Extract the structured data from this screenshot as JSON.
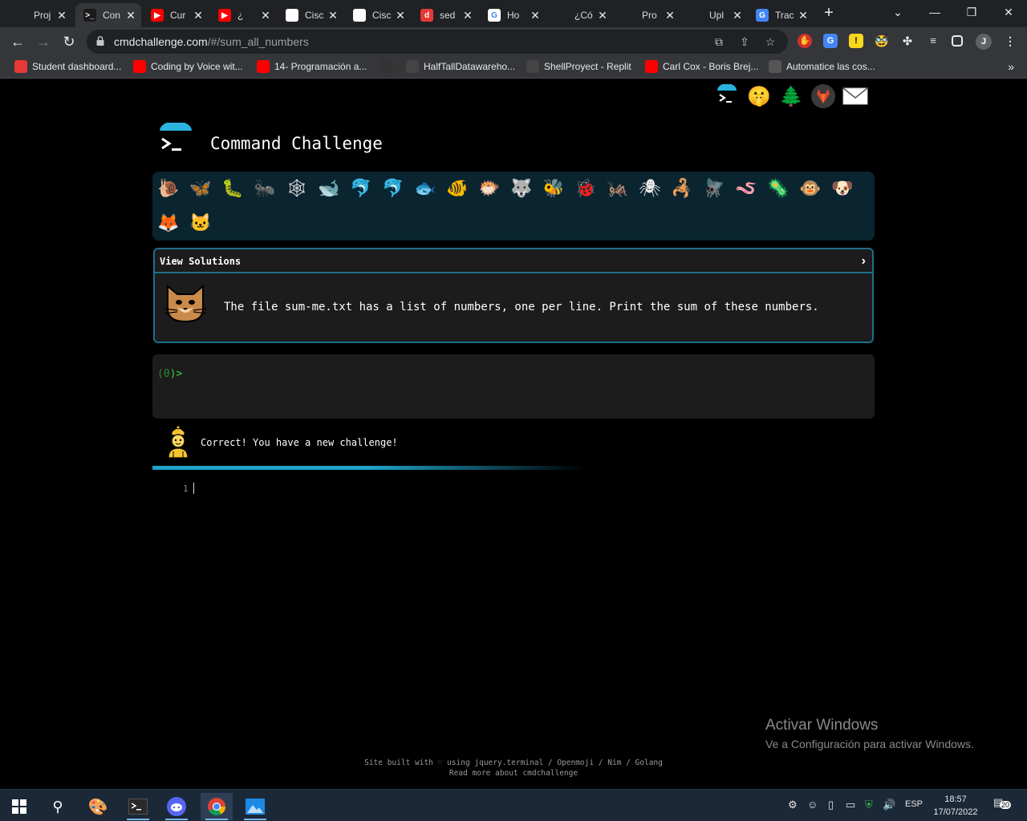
{
  "browser": {
    "tabs": [
      {
        "title": "Proj",
        "fav_color": "#202124",
        "fav_text": "",
        "active": false
      },
      {
        "title": "Con",
        "fav_color": "#1a1a1a",
        "fav_text": ">_",
        "active": true
      },
      {
        "title": "Cur",
        "fav_color": "#ff0000",
        "fav_text": "▶",
        "active": false
      },
      {
        "title": "¿",
        "fav_color": "#ff0000",
        "fav_text": "▶",
        "active": false
      },
      {
        "title": "Cisc",
        "fav_color": "#ffffff",
        "fav_text": "",
        "active": false
      },
      {
        "title": "Cisc",
        "fav_color": "#ffffff",
        "fav_text": "",
        "active": false
      },
      {
        "title": "sed",
        "fav_color": "#e53935",
        "fav_text": "d",
        "active": false
      },
      {
        "title": "Ho",
        "fav_color": "#ffffff",
        "fav_text": "G",
        "active": false
      },
      {
        "title": "¿Có",
        "fav_color": "#202124",
        "fav_text": "",
        "active": false
      },
      {
        "title": "Pro",
        "fav_color": "#202124",
        "fav_text": "",
        "active": false
      },
      {
        "title": "Upl",
        "fav_color": "#202124",
        "fav_text": "",
        "active": false
      },
      {
        "title": "Trac",
        "fav_color": "#4285f4",
        "fav_text": "G",
        "active": false
      }
    ],
    "new_tab": "+",
    "window_controls": {
      "minimize": "—",
      "restore": "❐",
      "close": "✕",
      "tab_search": "⌄"
    },
    "url_host": "cmdchallenge.com",
    "url_path": "/#/sum_all_numbers",
    "bookmarks": [
      {
        "label": "Student dashboard...",
        "icon_color": "#e53935"
      },
      {
        "label": "Coding by Voice wit...",
        "icon_color": "#ff0000"
      },
      {
        "label": "14- Programación a...",
        "icon_color": "#ff0000"
      },
      {
        "label": "",
        "icon_color": "#333333"
      },
      {
        "label": "HalfTallDatawareho...",
        "icon_color": "#444444"
      },
      {
        "label": "ShellProyect - Replit",
        "icon_color": "#444444"
      },
      {
        "label": "Carl Cox - Boris Brej...",
        "icon_color": "#ff0000"
      },
      {
        "label": "Automatice las cos...",
        "icon_color": "#555555"
      }
    ],
    "bookmarks_more": "»",
    "profile_initial": "J"
  },
  "page": {
    "title": "Command Challenge",
    "top_icons": [
      "terminal-icon",
      "shushing-face-icon",
      "tree-icon",
      "gitlab-icon",
      "mail-icon"
    ],
    "animals": [
      "🐌",
      "🦋",
      "🐛",
      "🐜",
      "🕸",
      "🐋",
      "🐬",
      "🐬",
      "🐟",
      "🐠",
      "🐡",
      "🐺",
      "🐝",
      "🐞",
      "🦗",
      "🕷",
      "🦂",
      "🪰",
      "🪱",
      "🦠",
      "🐵",
      "🐶",
      "🦊",
      "🐱"
    ],
    "challenge": {
      "header": "View Solutions",
      "chevron": "›",
      "description": "The file sum-me.txt has a list of numbers, one per line. Print the sum of these numbers."
    },
    "terminal": {
      "prompt_open": "(",
      "prompt_value": "0",
      "prompt_close": ")>"
    },
    "feedback": "Correct! You have a new challenge!",
    "editor_line": "1",
    "activate_title": "Activar Windows",
    "activate_sub": "Ve a Configuración para activar Windows.",
    "footer_line1": "Site built with ♡ using jquery.terminal / Openmoji / Nim / Golang",
    "footer_line2": "Read more about cmdchallenge"
  },
  "taskbar": {
    "language": "ESP",
    "time": "18:57",
    "date": "17/07/2022",
    "notifications": "20"
  }
}
